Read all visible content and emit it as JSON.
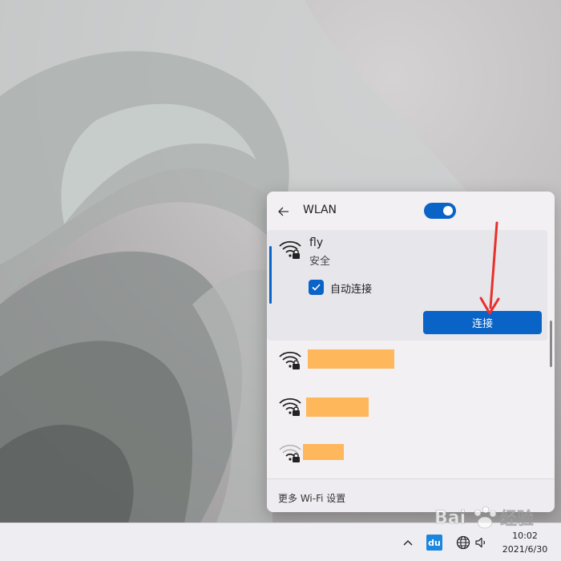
{
  "flyout": {
    "title": "WLAN",
    "wifi_enabled": true,
    "networks": [
      {
        "name": "fly",
        "status": "安全",
        "auto_connect_label": "自动连接",
        "auto_connect_checked": true,
        "connect_label": "连接",
        "secured": true,
        "signal_bars": 3
      },
      {
        "name": "",
        "secured": true,
        "signal_bars": 3
      },
      {
        "name": "",
        "secured": true,
        "signal_bars": 3
      },
      {
        "name": "",
        "secured": true,
        "signal_bars": 1
      }
    ],
    "more_settings_label": "更多 Wi-Fi 设置"
  },
  "taskbar": {
    "time": "10:02",
    "date": "2021/6/30",
    "tray_app_label": "du"
  },
  "watermark": {
    "text": "经验"
  },
  "colors": {
    "accent": "#0a63c7",
    "redaction": "#ffb75c",
    "annotation_arrow": "#e8302c"
  },
  "icons": [
    "back-arrow-icon",
    "wifi-lock-icon",
    "checkmark-icon",
    "chevron-up-icon",
    "globe-icon",
    "volume-icon"
  ]
}
